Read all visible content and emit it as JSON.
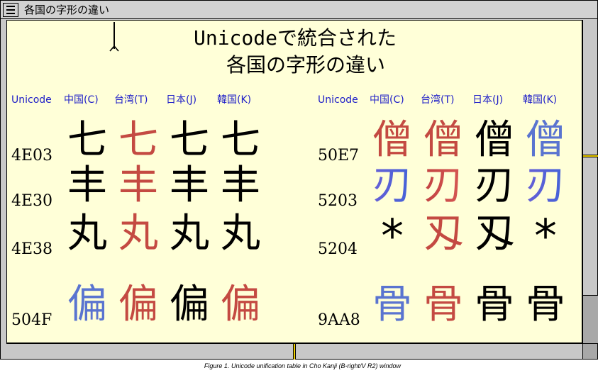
{
  "window": {
    "title": "各国の字形の違い"
  },
  "heading": {
    "line1": "Unicodeで統合された",
    "line2": "各国の字形の違い"
  },
  "columns": {
    "left": [
      "Unicode",
      "中国(C)",
      "台湾(T)",
      "日本(J)",
      "韓国(K)"
    ],
    "right": [
      "Unicode",
      "中国(C)",
      "台湾(T)",
      "日本(J)",
      "韓国(K)"
    ]
  },
  "left_rows": [
    {
      "code": "4E03",
      "glyphs": [
        "七",
        "七",
        "七",
        "七"
      ],
      "colors": [
        "black",
        "red",
        "black",
        "black"
      ]
    },
    {
      "code": "4E30",
      "glyphs": [
        "丰",
        "丰",
        "丰",
        "丰"
      ],
      "colors": [
        "black",
        "red",
        "black",
        "black"
      ]
    },
    {
      "code": "4E38",
      "glyphs": [
        "丸",
        "丸",
        "丸",
        "丸"
      ],
      "colors": [
        "black",
        "red",
        "black",
        "black"
      ]
    },
    {
      "code": "504F",
      "glyphs": [
        "偏",
        "偏",
        "偏",
        "偏"
      ],
      "colors": [
        "blue",
        "red",
        "black",
        "red"
      ]
    }
  ],
  "right_rows": [
    {
      "code": "50E7",
      "glyphs": [
        "僧",
        "僧",
        "僧",
        "僧"
      ],
      "colors": [
        "red",
        "red",
        "black",
        "blue"
      ]
    },
    {
      "code": "5203",
      "glyphs": [
        "刃",
        "刃",
        "刃",
        "刃"
      ],
      "colors": [
        "gradblue",
        "gradred",
        "black",
        "gradblue"
      ]
    },
    {
      "code": "5204",
      "glyphs": [
        "*",
        "刄",
        "刄",
        "*"
      ],
      "colors": [
        "black",
        "red",
        "black",
        "black"
      ]
    },
    {
      "code": "9AA8",
      "glyphs": [
        "骨",
        "骨",
        "骨",
        "骨"
      ],
      "colors": [
        "blue",
        "red",
        "black",
        "black"
      ]
    }
  ],
  "caption": "Figure 1. Unicode unification table in Cho Kanji (B-right/V R2) window"
}
